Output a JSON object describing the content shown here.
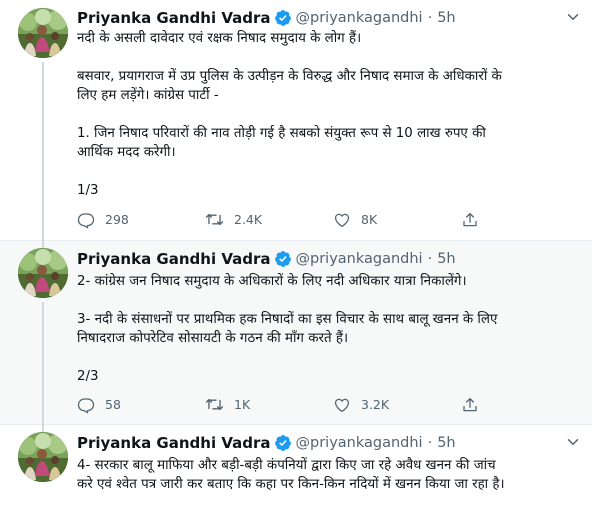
{
  "tweets": [
    {
      "author": {
        "name": "Priyanka Gandhi Vadra",
        "handle": "@priyankagandhi",
        "time": "5h"
      },
      "lines": [
        "नदी के असली दावेदार एवं रक्षक निषाद समुदाय के लोग हैं।",
        "",
        "बसवार, प्रयागराज में उप्र पुलिस के उत्पीड़न के विरुद्ध और निषाद समाज के अधिकारों के",
        "लिए हम लड़ेंगे। कांग्रेस पार्टी -",
        "",
        "1. जिन निषाद परिवारों की नाव तोड़ी गई है सबको संयुक्त रूप से 10 लाख रुपए की",
        "आर्थिक मदद करेगी।",
        "",
        "1/3"
      ],
      "stats": {
        "replies": "298",
        "retweets": "2.4K",
        "likes": "8K"
      }
    },
    {
      "author": {
        "name": "Priyanka Gandhi Vadra",
        "handle": "@priyankagandhi",
        "time": "5h"
      },
      "lines": [
        "2- कांग्रेस जन निषाद समुदाय के अधिकारों के लिए नदी अधिकार यात्रा निकालेंगे।",
        "",
        "3- नदी के संसाधनों पर प्राथमिक हक निषादों का इस विचार के साथ बालू खनन के लिए",
        "निषादराज कोपरेटिव सोसायटी के गठन की माँग करते हैं।",
        "",
        "2/3"
      ],
      "stats": {
        "replies": "58",
        "retweets": "1K",
        "likes": "3.2K"
      }
    },
    {
      "author": {
        "name": "Priyanka Gandhi Vadra",
        "handle": "@priyankagandhi",
        "time": "5h"
      },
      "lines": [
        "4- सरकार बालू माफिया और बड़ी-बड़ी कंपनियों द्वारा किए जा रहे अवैध खनन की जांच",
        "करे एवं श्वेत पत्र जारी कर बताए कि कहा पर किन-किन नदियों में खनन किया जा रहा है।"
      ]
    }
  ],
  "colors": {
    "verified": "#1d9bf0",
    "muted": "#536471",
    "divider": "#e6ecf0",
    "highlight": "#f7f9f9"
  },
  "icons": [
    "chevron-down-icon",
    "verified-badge-icon",
    "reply-icon",
    "retweet-icon",
    "like-icon",
    "share-icon"
  ]
}
